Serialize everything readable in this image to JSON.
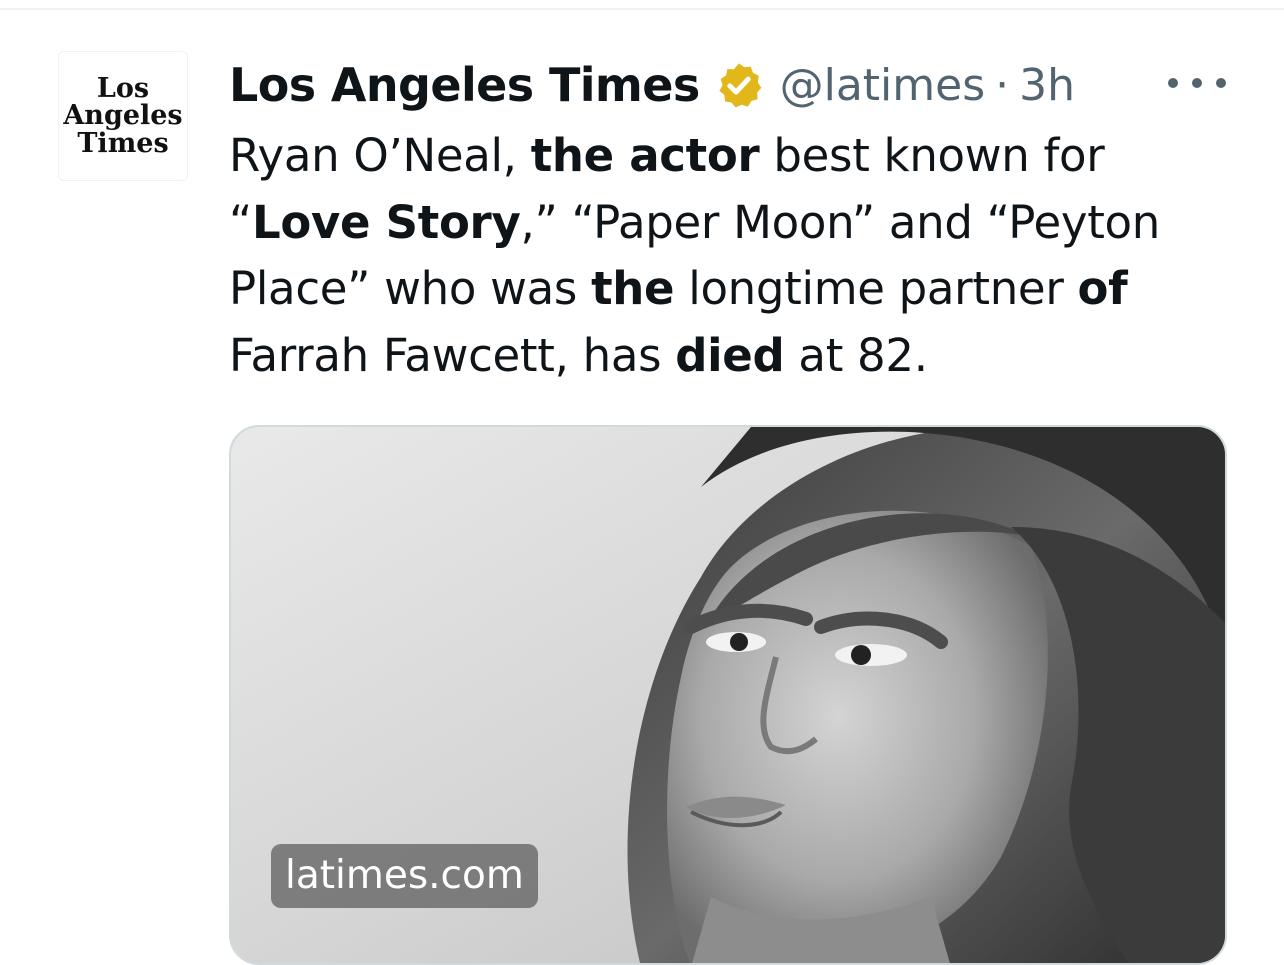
{
  "tweet": {
    "author": {
      "avatar_lines": [
        "Los",
        "Angeles",
        "Times"
      ],
      "name": "Los Angeles Times",
      "verified": true,
      "verified_badge_color": "#e2b719",
      "handle": "@latimes",
      "separator": "·",
      "time": "3h"
    },
    "text": {
      "s1": "Ryan O’Neal, ",
      "b1": "the actor",
      "s2": " best known for “",
      "b2": "Love Story",
      "s3": ",” “Paper Moon” and “Peyton Place” who was ",
      "b3": "the",
      "s4": " longtime partner ",
      "b4": "of",
      "s5": " Farrah Fawcett, has ",
      "b5": "died",
      "s6": " at 82."
    },
    "link_card": {
      "domain": "latimes.com",
      "image_subject": "black-and-white portrait photo"
    },
    "icons": {
      "verified": "verified-badge-icon",
      "more": "more-options-icon"
    }
  },
  "colors": {
    "text_primary": "#0f1419",
    "text_secondary": "#536471",
    "border": "#cfd9de"
  }
}
